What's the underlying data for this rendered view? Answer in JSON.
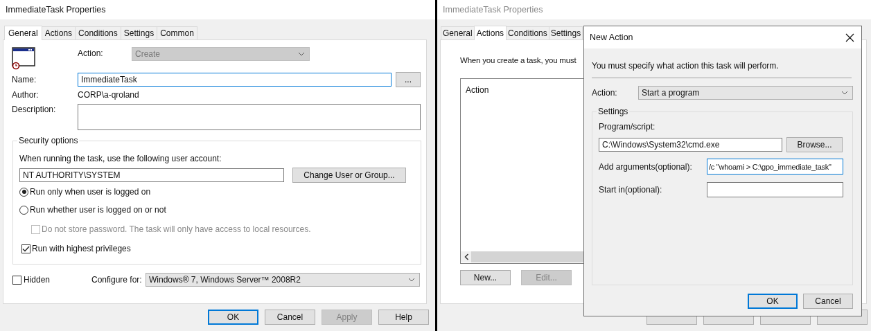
{
  "left": {
    "title": "ImmediateTask Properties",
    "tabs": [
      {
        "label": "General",
        "selected": true
      },
      {
        "label": "Actions",
        "selected": false
      },
      {
        "label": "Conditions",
        "selected": false
      },
      {
        "label": "Settings",
        "selected": false
      },
      {
        "label": "Common",
        "selected": false
      }
    ],
    "action": {
      "label": "Action:",
      "value": "Create",
      "disabled": true
    },
    "name": {
      "label": "Name:",
      "value": "ImmediateTask",
      "focused": true
    },
    "more_button": "...",
    "author": {
      "label": "Author:",
      "value": "CORP\\a-qroland"
    },
    "description": {
      "label": "Description:"
    },
    "security": {
      "title": "Security options",
      "prompt": "When running the task, use the following user account:",
      "account": "NT AUTHORITY\\SYSTEM",
      "change_button": "Change User or Group...",
      "options": [
        {
          "kind": "radio",
          "label": "Run only when user is logged on",
          "selected": true
        },
        {
          "kind": "radio",
          "label": "Run whether user is logged on or not",
          "selected": false
        },
        {
          "kind": "sub-checkbox",
          "label": "Do not store password. The task will only have access to local resources.",
          "checked": false,
          "disabled": true
        },
        {
          "kind": "checkbox",
          "label": "Run with highest privileges",
          "checked": true,
          "disabled": false
        }
      ]
    },
    "hidden": {
      "label": "Hidden",
      "checked": false
    },
    "configure": {
      "label": "Configure for:",
      "value": "Windows® 7, Windows Server™ 2008R2"
    },
    "buttons": [
      {
        "label": "OK",
        "default": true,
        "disabled": false
      },
      {
        "label": "Cancel",
        "default": false,
        "disabled": false
      },
      {
        "label": "Apply",
        "default": false,
        "disabled": true
      },
      {
        "label": "Help",
        "default": false,
        "disabled": false
      }
    ]
  },
  "right": {
    "title": "ImmediateTask Properties",
    "tabs": [
      {
        "label": "General",
        "selected": false
      },
      {
        "label": "Actions",
        "selected": true
      },
      {
        "label": "Conditions",
        "selected": false
      },
      {
        "label": "Settings",
        "selected": false
      }
    ],
    "intro": "When you create a task, you must",
    "list": {
      "column": "Action"
    },
    "list_buttons": [
      {
        "label": "New...",
        "disabled": false
      },
      {
        "label": "Edit...",
        "disabled": true
      }
    ]
  },
  "dialog": {
    "title": "New Action",
    "instruction": "You must specify what action this task will perform.",
    "action": {
      "label": "Action:",
      "value": "Start a program"
    },
    "settings": {
      "title": "Settings",
      "program": {
        "label": "Program/script:",
        "value": "C:\\Windows\\System32\\cmd.exe"
      },
      "browse_button": "Browse...",
      "arguments": {
        "label": "Add arguments(optional):",
        "value": "/c \"whoami > C:\\gpo_immediate_task\"",
        "focused": true
      },
      "start_in": {
        "label": "Start in(optional):",
        "focused": false
      }
    },
    "buttons": [
      {
        "label": "OK",
        "default": true,
        "disabled": false
      },
      {
        "label": "Cancel",
        "default": false,
        "disabled": false
      }
    ]
  }
}
